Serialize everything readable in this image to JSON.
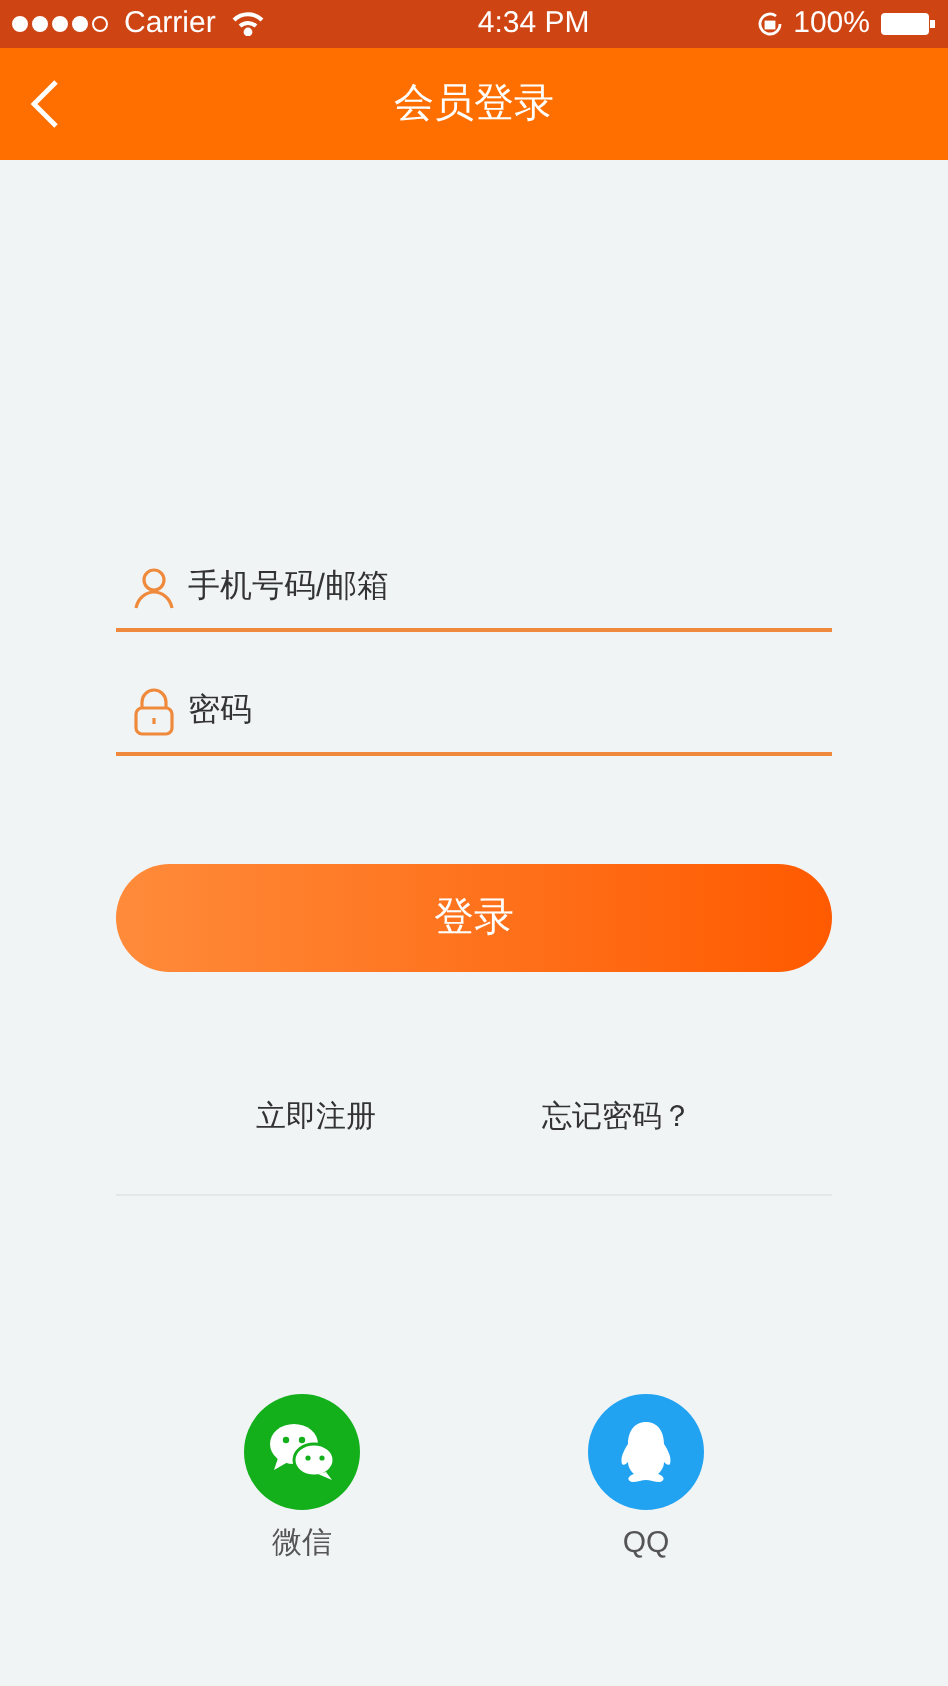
{
  "status_bar": {
    "carrier": "Carrier",
    "time": "4:34 PM",
    "battery": "100%"
  },
  "nav_bar": {
    "title": "会员登录"
  },
  "fields": [
    {
      "kind": "user",
      "placeholder": "手机号码/邮箱"
    },
    {
      "kind": "lock",
      "placeholder": "密码"
    }
  ],
  "login_button": "登录",
  "links": [
    "立即注册",
    "忘记密码？"
  ],
  "social_logins": [
    {
      "kind": "wechat",
      "label": "微信",
      "color": "#14b01c"
    },
    {
      "kind": "qq",
      "label": "QQ",
      "color": "#22a3f2"
    }
  ]
}
